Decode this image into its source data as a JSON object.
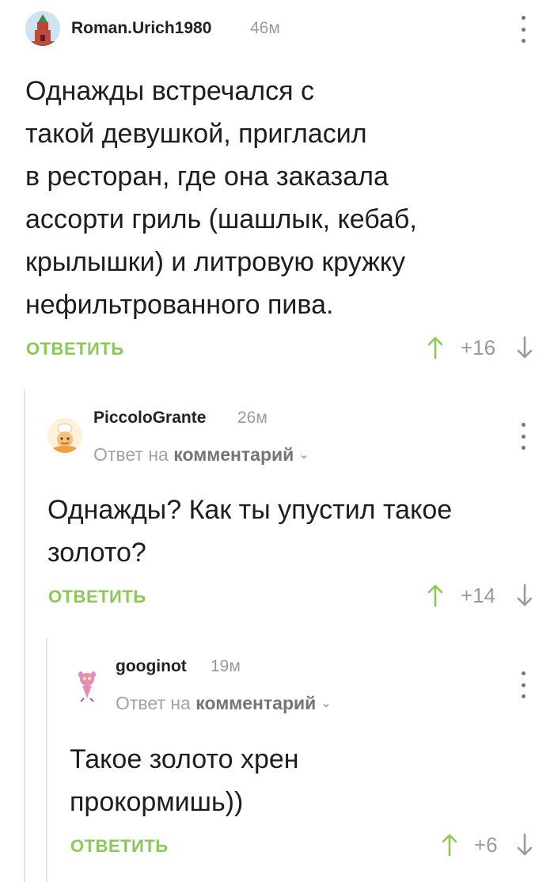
{
  "comments": [
    {
      "author": "Roman.Urich1980",
      "time": "46м",
      "text": [
        "Однажды встречался с",
        "такой девушкой, пригласил",
        "в ресторан, где она заказала",
        "ассорти гриль (шашлык, кебаб,",
        "крылышки) и литровую кружку",
        "нефильтрованного пива."
      ],
      "reply_label": "ОТВЕТИТЬ",
      "rating": "+16"
    },
    {
      "author": "PiccoloGrante",
      "time": "26м",
      "reply_to_prefix": "Ответ на",
      "reply_to_link": "комментарий",
      "text": [
        "Однажды? Как ты упустил такое",
        "золото?"
      ],
      "reply_label": "ОТВЕТИТЬ",
      "rating": "+14"
    },
    {
      "author": "googinot",
      "time": "19м",
      "reply_to_prefix": "Ответ на",
      "reply_to_link": "комментарий",
      "text": [
        "Такое золото хрен",
        "прокормишь))"
      ],
      "reply_label": "ОТВЕТИТЬ",
      "rating": "+6"
    }
  ],
  "colors": {
    "accent_green": "#8ac858",
    "vote_arrow_up": "#8ac858",
    "vote_arrow_down": "#9a9a9a",
    "muted_text": "#9a9a9a"
  },
  "icons": {
    "avatar_1": "kremlin-tower-avatar",
    "avatar_2": "chef-avatar",
    "avatar_3": "pink-panther-avatar",
    "menu": "more-vertical-icon",
    "upvote": "arrow-up-icon",
    "downvote": "arrow-down-icon"
  }
}
